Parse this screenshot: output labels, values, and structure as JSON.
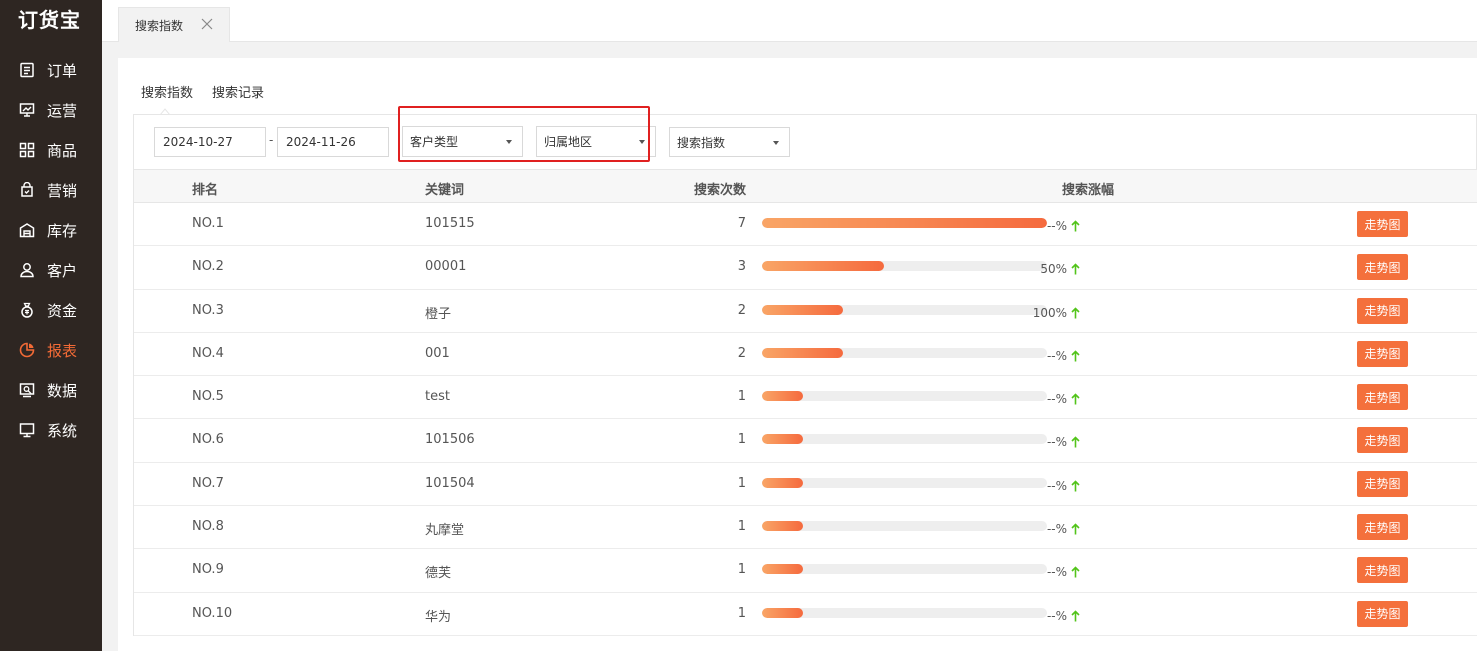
{
  "app": {
    "logo": "订货宝"
  },
  "sidebar": {
    "items": [
      {
        "label": "订单",
        "icon": "order-icon",
        "active": false
      },
      {
        "label": "运营",
        "icon": "operation-icon",
        "active": false
      },
      {
        "label": "商品",
        "icon": "product-icon",
        "active": false
      },
      {
        "label": "营销",
        "icon": "marketing-icon",
        "active": false
      },
      {
        "label": "库存",
        "icon": "inventory-icon",
        "active": false
      },
      {
        "label": "客户",
        "icon": "customer-icon",
        "active": false
      },
      {
        "label": "资金",
        "icon": "funds-icon",
        "active": false
      },
      {
        "label": "报表",
        "icon": "report-icon",
        "active": true
      },
      {
        "label": "数据",
        "icon": "data-icon",
        "active": false
      },
      {
        "label": "系统",
        "icon": "system-icon",
        "active": false
      }
    ],
    "active_color": "#f26a36"
  },
  "tabs": {
    "page_tab": "搜索指数"
  },
  "subtabs": [
    "搜索指数",
    "搜索记录"
  ],
  "filters": {
    "start_date": "2024-10-27",
    "separator": "-",
    "end_date": "2024-11-26",
    "customer_type": "客户类型",
    "region": "归属地区",
    "metric": "搜索指数"
  },
  "table": {
    "headers": {
      "rank": "排名",
      "keyword": "关键词",
      "count": "搜索次数",
      "growth": "搜索涨幅"
    },
    "button_label": "走势图",
    "max_count": 7,
    "rows": [
      {
        "rank": "NO.1",
        "keyword": "101515",
        "count": "7",
        "value": 7,
        "growth": "--%"
      },
      {
        "rank": "NO.2",
        "keyword": "00001",
        "count": "3",
        "value": 3,
        "growth": "50%"
      },
      {
        "rank": "NO.3",
        "keyword": "橙子",
        "count": "2",
        "value": 2,
        "growth": "100%"
      },
      {
        "rank": "NO.4",
        "keyword": "001",
        "count": "2",
        "value": 2,
        "growth": "--%"
      },
      {
        "rank": "NO.5",
        "keyword": "test",
        "count": "1",
        "value": 1,
        "growth": "--%"
      },
      {
        "rank": "NO.6",
        "keyword": "101506",
        "count": "1",
        "value": 1,
        "growth": "--%"
      },
      {
        "rank": "NO.7",
        "keyword": "101504",
        "count": "1",
        "value": 1,
        "growth": "--%"
      },
      {
        "rank": "NO.8",
        "keyword": "丸摩堂",
        "count": "1",
        "value": 1,
        "growth": "--%"
      },
      {
        "rank": "NO.9",
        "keyword": "德芙",
        "count": "1",
        "value": 1,
        "growth": "--%"
      },
      {
        "rank": "NO.10",
        "keyword": "华为",
        "count": "1",
        "value": 1,
        "growth": "--%"
      }
    ]
  },
  "colors": {
    "accent": "#f4703c",
    "up_arrow": "#52c41a",
    "highlight_box": "#e02020"
  }
}
